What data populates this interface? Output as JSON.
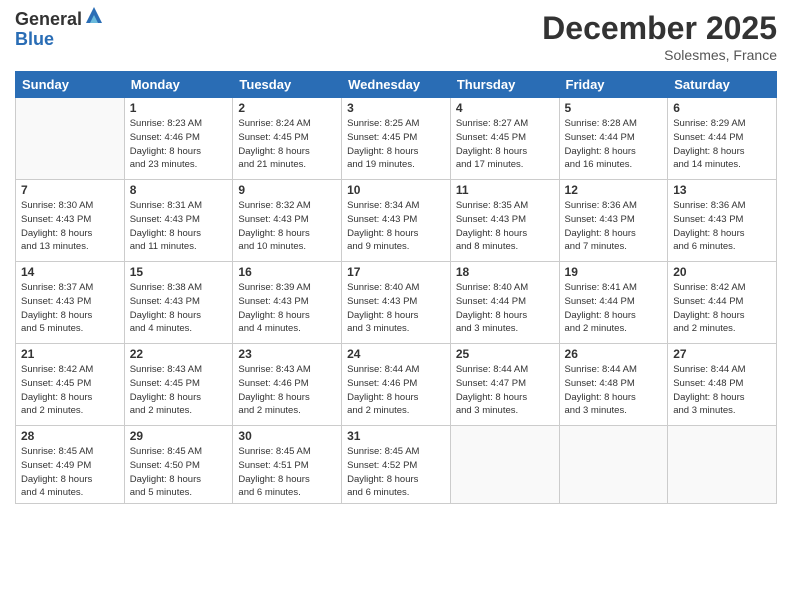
{
  "logo": {
    "general": "General",
    "blue": "Blue"
  },
  "title": "December 2025",
  "location": "Solesmes, France",
  "weekdays": [
    "Sunday",
    "Monday",
    "Tuesday",
    "Wednesday",
    "Thursday",
    "Friday",
    "Saturday"
  ],
  "weeks": [
    [
      {
        "day": "",
        "info": ""
      },
      {
        "day": "1",
        "info": "Sunrise: 8:23 AM\nSunset: 4:46 PM\nDaylight: 8 hours\nand 23 minutes."
      },
      {
        "day": "2",
        "info": "Sunrise: 8:24 AM\nSunset: 4:45 PM\nDaylight: 8 hours\nand 21 minutes."
      },
      {
        "day": "3",
        "info": "Sunrise: 8:25 AM\nSunset: 4:45 PM\nDaylight: 8 hours\nand 19 minutes."
      },
      {
        "day": "4",
        "info": "Sunrise: 8:27 AM\nSunset: 4:45 PM\nDaylight: 8 hours\nand 17 minutes."
      },
      {
        "day": "5",
        "info": "Sunrise: 8:28 AM\nSunset: 4:44 PM\nDaylight: 8 hours\nand 16 minutes."
      },
      {
        "day": "6",
        "info": "Sunrise: 8:29 AM\nSunset: 4:44 PM\nDaylight: 8 hours\nand 14 minutes."
      }
    ],
    [
      {
        "day": "7",
        "info": "Sunrise: 8:30 AM\nSunset: 4:43 PM\nDaylight: 8 hours\nand 13 minutes."
      },
      {
        "day": "8",
        "info": "Sunrise: 8:31 AM\nSunset: 4:43 PM\nDaylight: 8 hours\nand 11 minutes."
      },
      {
        "day": "9",
        "info": "Sunrise: 8:32 AM\nSunset: 4:43 PM\nDaylight: 8 hours\nand 10 minutes."
      },
      {
        "day": "10",
        "info": "Sunrise: 8:34 AM\nSunset: 4:43 PM\nDaylight: 8 hours\nand 9 minutes."
      },
      {
        "day": "11",
        "info": "Sunrise: 8:35 AM\nSunset: 4:43 PM\nDaylight: 8 hours\nand 8 minutes."
      },
      {
        "day": "12",
        "info": "Sunrise: 8:36 AM\nSunset: 4:43 PM\nDaylight: 8 hours\nand 7 minutes."
      },
      {
        "day": "13",
        "info": "Sunrise: 8:36 AM\nSunset: 4:43 PM\nDaylight: 8 hours\nand 6 minutes."
      }
    ],
    [
      {
        "day": "14",
        "info": "Sunrise: 8:37 AM\nSunset: 4:43 PM\nDaylight: 8 hours\nand 5 minutes."
      },
      {
        "day": "15",
        "info": "Sunrise: 8:38 AM\nSunset: 4:43 PM\nDaylight: 8 hours\nand 4 minutes."
      },
      {
        "day": "16",
        "info": "Sunrise: 8:39 AM\nSunset: 4:43 PM\nDaylight: 8 hours\nand 4 minutes."
      },
      {
        "day": "17",
        "info": "Sunrise: 8:40 AM\nSunset: 4:43 PM\nDaylight: 8 hours\nand 3 minutes."
      },
      {
        "day": "18",
        "info": "Sunrise: 8:40 AM\nSunset: 4:44 PM\nDaylight: 8 hours\nand 3 minutes."
      },
      {
        "day": "19",
        "info": "Sunrise: 8:41 AM\nSunset: 4:44 PM\nDaylight: 8 hours\nand 2 minutes."
      },
      {
        "day": "20",
        "info": "Sunrise: 8:42 AM\nSunset: 4:44 PM\nDaylight: 8 hours\nand 2 minutes."
      }
    ],
    [
      {
        "day": "21",
        "info": "Sunrise: 8:42 AM\nSunset: 4:45 PM\nDaylight: 8 hours\nand 2 minutes."
      },
      {
        "day": "22",
        "info": "Sunrise: 8:43 AM\nSunset: 4:45 PM\nDaylight: 8 hours\nand 2 minutes."
      },
      {
        "day": "23",
        "info": "Sunrise: 8:43 AM\nSunset: 4:46 PM\nDaylight: 8 hours\nand 2 minutes."
      },
      {
        "day": "24",
        "info": "Sunrise: 8:44 AM\nSunset: 4:46 PM\nDaylight: 8 hours\nand 2 minutes."
      },
      {
        "day": "25",
        "info": "Sunrise: 8:44 AM\nSunset: 4:47 PM\nDaylight: 8 hours\nand 3 minutes."
      },
      {
        "day": "26",
        "info": "Sunrise: 8:44 AM\nSunset: 4:48 PM\nDaylight: 8 hours\nand 3 minutes."
      },
      {
        "day": "27",
        "info": "Sunrise: 8:44 AM\nSunset: 4:48 PM\nDaylight: 8 hours\nand 3 minutes."
      }
    ],
    [
      {
        "day": "28",
        "info": "Sunrise: 8:45 AM\nSunset: 4:49 PM\nDaylight: 8 hours\nand 4 minutes."
      },
      {
        "day": "29",
        "info": "Sunrise: 8:45 AM\nSunset: 4:50 PM\nDaylight: 8 hours\nand 5 minutes."
      },
      {
        "day": "30",
        "info": "Sunrise: 8:45 AM\nSunset: 4:51 PM\nDaylight: 8 hours\nand 6 minutes."
      },
      {
        "day": "31",
        "info": "Sunrise: 8:45 AM\nSunset: 4:52 PM\nDaylight: 8 hours\nand 6 minutes."
      },
      {
        "day": "",
        "info": ""
      },
      {
        "day": "",
        "info": ""
      },
      {
        "day": "",
        "info": ""
      }
    ]
  ]
}
